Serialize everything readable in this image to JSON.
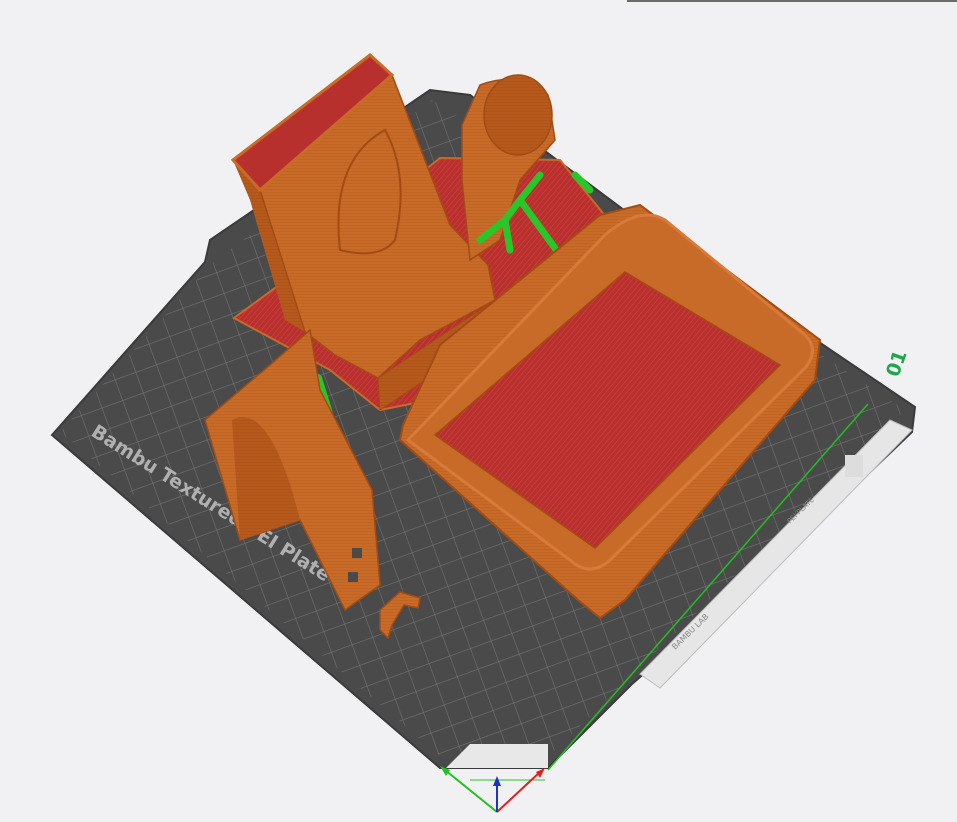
{
  "viewport": {
    "plate_name": "Bambu Textured PEI Plate",
    "plate_number": "01",
    "strip_text_1": "BAMBU LAB",
    "strip_text_2": "PEI PLATE"
  },
  "colors": {
    "background": "#f1f1f3",
    "plate_dark": "#4a4a4a",
    "grid_line": "#7a7a7a",
    "wall_orange": "#c86a28",
    "infill_red": "#b8302e",
    "support_green": "#28c628",
    "axis_x": "#e02020",
    "axis_y": "#22c022",
    "axis_z": "#2030d0",
    "plate_number_color": "#1fa84a"
  },
  "icons": [
    "bed-handle-icon",
    "axis-gizmo-icon"
  ]
}
